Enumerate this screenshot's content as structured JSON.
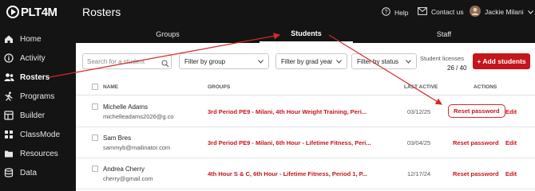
{
  "app": {
    "logo_text": "PLT4M"
  },
  "header": {
    "title": "Rosters",
    "help": "Help",
    "contact": "Contact us",
    "user": "Jackie Milani"
  },
  "sidebar": {
    "items": [
      {
        "label": "Home",
        "icon": "home-icon"
      },
      {
        "label": "Activity",
        "icon": "info-icon"
      },
      {
        "label": "Rosters",
        "icon": "users-icon",
        "active": true
      },
      {
        "label": "Programs",
        "icon": "runner-icon"
      },
      {
        "label": "Builder",
        "icon": "builder-icon"
      },
      {
        "label": "ClassMode",
        "icon": "grid-icon"
      },
      {
        "label": "Resources",
        "icon": "folder-icon"
      },
      {
        "label": "Data",
        "icon": "database-icon"
      }
    ]
  },
  "tabs": [
    {
      "label": "Groups"
    },
    {
      "label": "Students",
      "active": true
    },
    {
      "label": "Staff"
    }
  ],
  "filters": {
    "search_placeholder": "Search for a student",
    "group": "Filter by group",
    "grad_year": "Filter by grad year",
    "status": "Filter by status"
  },
  "licenses": {
    "label": "Student licenses",
    "value": "26 / 40"
  },
  "add_button": "+ Add students",
  "table": {
    "headers": {
      "name": "NAME",
      "groups": "GROUPS",
      "last_active": "LAST ACTIVE",
      "actions": "ACTIONS"
    },
    "rows": [
      {
        "name": "Michelle Adams",
        "email": "michelleadams2026@g.co",
        "groups": "3rd Period PE9 - Milani, 4th Hour Weight Training, Peri...",
        "last_active": "03/12/25",
        "reset": "Reset password",
        "edit": "Edit"
      },
      {
        "name": "Sam Bres",
        "email": "sammyb@mailinator.com",
        "groups": "3rd Period PE9 - Milani, 6th Hour - Lifetime Fitness, Peri...",
        "last_active": "03/04/25",
        "reset": "Reset password",
        "edit": "Edit"
      },
      {
        "name": "Andrea Cherry",
        "email": "cherry@gmail.com",
        "groups": "4th Hour S & C, 6th Hour - Lifetime Fitness, Period 1, P...",
        "last_active": "12/17/24",
        "reset": "Reset password",
        "edit": "Edit"
      }
    ]
  },
  "colors": {
    "accent": "#c4161c",
    "dark": "#141414",
    "annotation": "#d42828"
  }
}
